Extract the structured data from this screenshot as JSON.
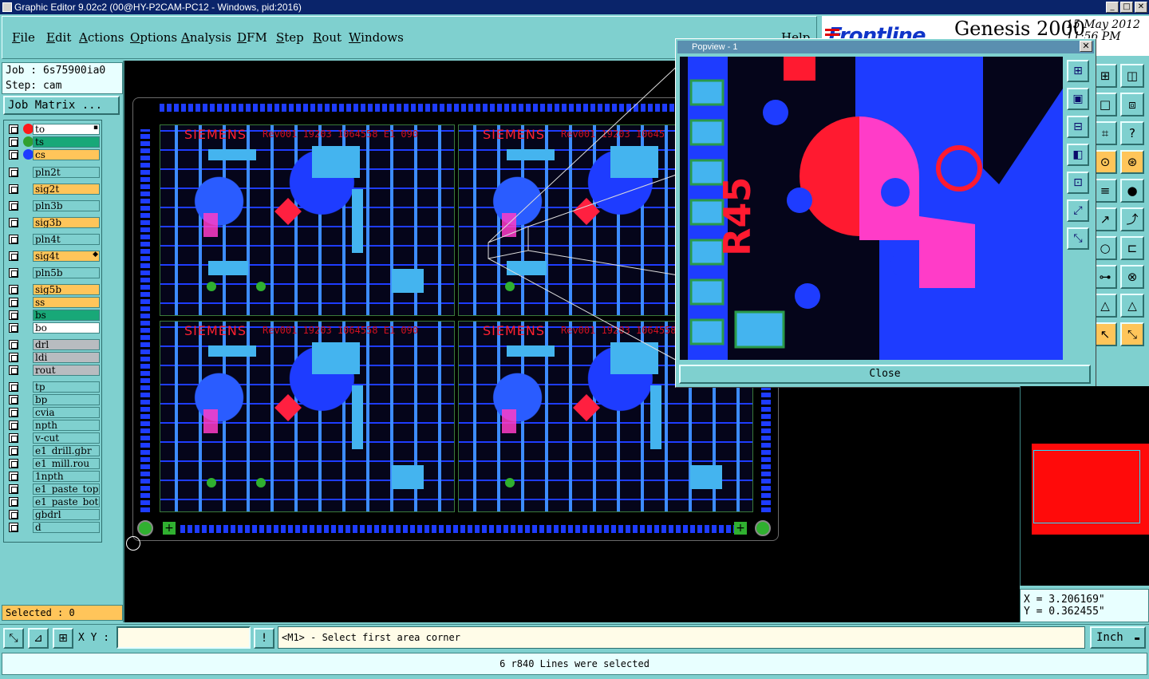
{
  "window": {
    "title": "Graphic Editor 9.02c2 (00@HY-P2CAM-PC12 - Windows, pid:2016)",
    "min": "_",
    "max": "□",
    "close": "✕"
  },
  "menu": {
    "items": [
      "File",
      "Edit",
      "Actions",
      "Options",
      "Analysis",
      "DFM",
      "Step",
      "Rout",
      "Windows"
    ],
    "help": "Help"
  },
  "brand": {
    "logo": "Frontline",
    "product": "Genesis 2000",
    "date": "15 May 2012",
    "time": "11:56 PM"
  },
  "job": {
    "job_label": "Job : 6s75900ia0",
    "step_label": "Step: cam",
    "matrix_button": "Job Matrix ..."
  },
  "layers": [
    {
      "name": "to",
      "color": "#ffffff",
      "dot": "#ff1a1a",
      "marker": "▪"
    },
    {
      "name": "ts",
      "color": "#18a878",
      "dot": "#30a030",
      "marker": ""
    },
    {
      "name": "cs",
      "color": "#ffc55a",
      "dot": "#1e3cff",
      "marker": ""
    },
    {
      "name": "pln2t",
      "color": "#7fd0cf",
      "dot": "",
      "marker": ""
    },
    {
      "name": "sig2t",
      "color": "#ffc55a",
      "dot": "",
      "marker": ""
    },
    {
      "name": "pln3b",
      "color": "#7fd0cf",
      "dot": "",
      "marker": ""
    },
    {
      "name": "sig3b",
      "color": "#ffc55a",
      "dot": "",
      "marker": ""
    },
    {
      "name": "pln4t",
      "color": "#7fd0cf",
      "dot": "",
      "marker": ""
    },
    {
      "name": "sig4t",
      "color": "#ffc55a",
      "dot": "",
      "marker": "◆"
    },
    {
      "name": "pln5b",
      "color": "#7fd0cf",
      "dot": "",
      "marker": ""
    },
    {
      "name": "sig5b",
      "color": "#ffc55a",
      "dot": "",
      "marker": ""
    },
    {
      "name": "ss",
      "color": "#ffc55a",
      "dot": "",
      "marker": ""
    },
    {
      "name": "bs",
      "color": "#18a878",
      "dot": "",
      "marker": ""
    },
    {
      "name": "bo",
      "color": "#ffffff",
      "dot": "",
      "marker": ""
    },
    {
      "name": "drl",
      "color": "#b8bcc0",
      "dot": "",
      "marker": ""
    },
    {
      "name": "ldi",
      "color": "#b8bcc0",
      "dot": "",
      "marker": ""
    },
    {
      "name": "rout",
      "color": "#b8bcc0",
      "dot": "",
      "marker": ""
    },
    {
      "name": "tp",
      "color": "#7fd0cf",
      "dot": "",
      "marker": ""
    },
    {
      "name": "bp",
      "color": "#7fd0cf",
      "dot": "",
      "marker": ""
    },
    {
      "name": "cvia",
      "color": "#7fd0cf",
      "dot": "",
      "marker": ""
    },
    {
      "name": "npth",
      "color": "#7fd0cf",
      "dot": "",
      "marker": ""
    },
    {
      "name": "v-cut",
      "color": "#7fd0cf",
      "dot": "",
      "marker": ""
    },
    {
      "name": "e1_drill.gbr",
      "color": "#7fd0cf",
      "dot": "",
      "marker": ""
    },
    {
      "name": "e1_mill.rou",
      "color": "#7fd0cf",
      "dot": "",
      "marker": ""
    },
    {
      "name": "1npth",
      "color": "#7fd0cf",
      "dot": "",
      "marker": ""
    },
    {
      "name": "e1_paste_top",
      "color": "#7fd0cf",
      "dot": "",
      "marker": ""
    },
    {
      "name": "e1_paste_bot",
      "color": "#7fd0cf",
      "dot": "",
      "marker": ""
    },
    {
      "name": "gbdrl",
      "color": "#7fd0cf",
      "dot": "",
      "marker": ""
    },
    {
      "name": "d",
      "color": "#7fd0cf",
      "dot": "",
      "marker": ""
    }
  ],
  "selected": "Selected : 0",
  "boards": {
    "brand": "SIEMENS",
    "rev": "Rev001 19203 1064558 E1 090",
    "rev_short": "Rev001 19203 10645"
  },
  "popview": {
    "title": "Popview - 1",
    "close_x": "✕",
    "close_button": "Close",
    "label_r45": "R45",
    "tools": [
      "⊞",
      "▣",
      "⊟",
      "◧",
      "⊡",
      "⤢",
      "⤡"
    ]
  },
  "right_tools": [
    "⊞",
    "◫",
    "□",
    "⧈",
    "⌗",
    "?",
    "⊙",
    "⊛",
    "≡",
    "●",
    "↗",
    "⤴",
    "○",
    "⊏",
    "⊶",
    "⊗",
    "△",
    "△",
    "↖",
    "⤡"
  ],
  "coords": {
    "x": "X = 3.206169\"",
    "y": "Y = 0.362455\""
  },
  "bottom": {
    "xy_label": "X Y :",
    "xy_value": "",
    "excl": "!",
    "prompt": "<M1> - Select first area corner",
    "unit": "Inch",
    "unit_arrow": "▬",
    "icons": [
      "⤡",
      "⊿",
      "⊞"
    ]
  },
  "status": "6 r840 Lines were selected",
  "colors": {
    "panel": "#7fd0cf",
    "canvas": "#000000",
    "copper_blue": "#1e3cff",
    "pad_cyan": "#44b4ef",
    "silk_red": "#ff2030",
    "magenta": "#ff3cc8"
  }
}
